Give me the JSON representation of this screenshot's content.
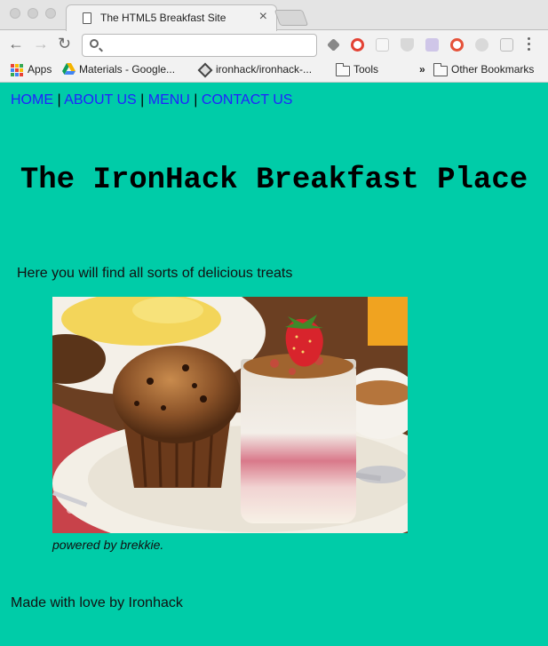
{
  "browser": {
    "tab_title": "The HTML5 Breakfast Site",
    "tab_close": "×",
    "address_value": "",
    "back_glyph": "←",
    "forward_glyph": "→",
    "reload_glyph": "↻",
    "bookmarks": {
      "apps": "Apps",
      "materials": "Materials - Google...",
      "github": "ironhack/ironhack-...",
      "tools": "Tools",
      "overflow": "»",
      "other": "Other Bookmarks"
    }
  },
  "site": {
    "nav": [
      {
        "label": "HOME"
      },
      {
        "label": "ABOUT US"
      },
      {
        "label": "MENU"
      },
      {
        "label": "CONTACT US"
      }
    ],
    "nav_separator": "|",
    "title": "The IronHack Breakfast Place",
    "intro": "Here you will find all sorts of delicious treats",
    "image_caption": "powered by brekkie.",
    "footer": "Made with love by Ironhack"
  },
  "colors": {
    "page_background": "#00cca8",
    "link": "#2121ff"
  }
}
